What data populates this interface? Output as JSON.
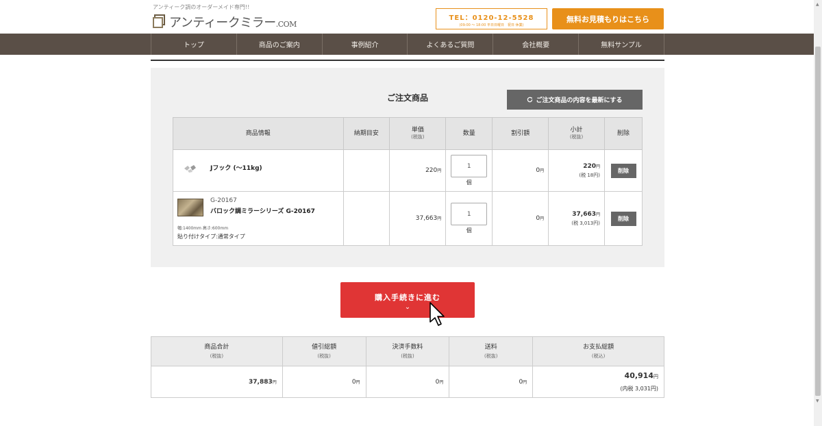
{
  "header": {
    "tagline": "アンティーク調のオーダーメイド専門!!",
    "logo_main": "アンティークミラー",
    "logo_suffix": ".COM",
    "tel_number": "TEL：0120-12-5528",
    "tel_hours": "(09:00 ～ 18:00 平日日曜日　祝日 休業)",
    "quote_button": "無料お見積もりはこちら"
  },
  "nav": {
    "items": [
      "トップ",
      "商品のご案内",
      "事例紹介",
      "よくあるご質問",
      "会社概要",
      "無料サンプル"
    ]
  },
  "order": {
    "title": "ご注文商品",
    "refresh_button": "ご注文商品の内容を最新にする",
    "columns": [
      {
        "label": "商品情報",
        "sub": ""
      },
      {
        "label": "納期目安",
        "sub": ""
      },
      {
        "label": "単価",
        "sub": "(税抜)"
      },
      {
        "label": "数量",
        "sub": ""
      },
      {
        "label": "割引額",
        "sub": ""
      },
      {
        "label": "小計",
        "sub": "(税抜)"
      },
      {
        "label": "削除",
        "sub": ""
      }
    ],
    "rows": [
      {
        "code": "",
        "name": "Jフック (～11kg)",
        "size": "",
        "type": "",
        "lead_time": "",
        "price": "220",
        "qty": "1",
        "qty_unit": "個",
        "discount": "0",
        "subtotal": "220",
        "subtotal_tax": "(税 18円)",
        "delete": "削除"
      },
      {
        "code": "G-20167",
        "name": "バロック調ミラーシリーズ G-20167",
        "size": "幅:1400mm 高さ:600mm",
        "type": "貼り付けタイプ:通常タイプ",
        "lead_time": "",
        "price": "37,663",
        "qty": "1",
        "qty_unit": "個",
        "discount": "0",
        "subtotal": "37,663",
        "subtotal_tax": "(税 3,013円)",
        "delete": "削除"
      }
    ],
    "yen": "円"
  },
  "checkout": {
    "label": "購入手続きに進む",
    "chevron": "⌄"
  },
  "totals": {
    "columns": [
      {
        "label": "商品合計",
        "sub": "(税抜)"
      },
      {
        "label": "値引総額",
        "sub": "(税抜)"
      },
      {
        "label": "決済手数料",
        "sub": "(税抜)"
      },
      {
        "label": "送料",
        "sub": "(税抜)"
      },
      {
        "label": "お支払総額",
        "sub": "(税込)"
      }
    ],
    "values": {
      "items_total": "37,883",
      "discount_total": "0",
      "payment_fee": "0",
      "shipping": "0",
      "grand_total": "40,914",
      "grand_tax": "(内税 3,031円)"
    }
  },
  "colors": {
    "accent_orange": "#e8901a",
    "nav_brown": "#5a4f47",
    "checkout_red": "#e03535",
    "button_gray": "#666666"
  }
}
